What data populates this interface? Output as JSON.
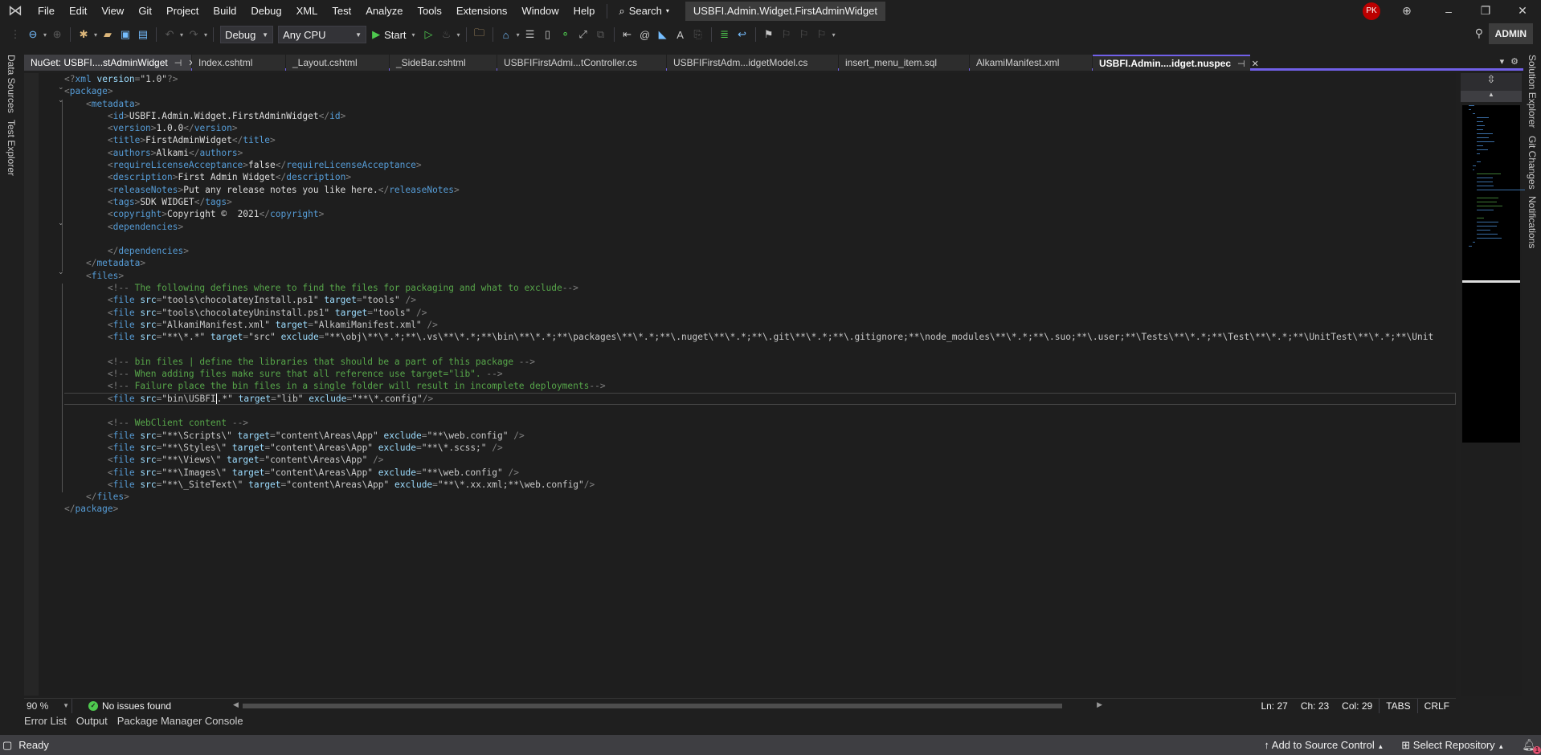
{
  "menubar": {
    "items": [
      "File",
      "Edit",
      "View",
      "Git",
      "Project",
      "Build",
      "Debug",
      "XML",
      "Test",
      "Analyze",
      "Tools",
      "Extensions",
      "Window",
      "Help"
    ],
    "search_label": "Search",
    "solution_title": "USBFI.Admin.Widget.FirstAdminWidget",
    "user_initials": "PK"
  },
  "toolbar": {
    "config": "Debug",
    "platform": "Any CPU",
    "start_label": "Start",
    "admin_label": "ADMIN"
  },
  "side_panels": {
    "left": [
      "Data Sources",
      "Test Explorer"
    ],
    "right": [
      "Solution Explorer",
      "Git Changes",
      "Notifications"
    ]
  },
  "tabs": [
    {
      "label": "NuGet: USBFI....stAdminWidget",
      "pinned": true,
      "state": "preview"
    },
    {
      "label": "Index.cshtml"
    },
    {
      "label": "_Layout.cshtml"
    },
    {
      "label": "_SideBar.cshtml"
    },
    {
      "label": "USBFIFirstAdmi...tController.cs"
    },
    {
      "label": "USBFIFirstAdm...idgetModel.cs"
    },
    {
      "label": "insert_menu_item.sql"
    },
    {
      "label": "AlkamiManifest.xml"
    },
    {
      "label": "USBFI.Admin....idget.nuspec",
      "pinned": true,
      "state": "active"
    }
  ],
  "editor": {
    "lines": [
      [
        [
          "p",
          "<?"
        ],
        [
          "t",
          "xml"
        ],
        [
          "x",
          " "
        ],
        [
          "a",
          "version"
        ],
        [
          "p",
          "="
        ],
        [
          "v",
          "\"1.0\""
        ],
        [
          "p",
          "?>"
        ]
      ],
      [
        [
          "p",
          "<"
        ],
        [
          "t",
          "package"
        ],
        [
          "p",
          ">"
        ]
      ],
      [
        [
          "x",
          "    "
        ],
        [
          "p",
          "<"
        ],
        [
          "t",
          "metadata"
        ],
        [
          "p",
          ">"
        ]
      ],
      [
        [
          "x",
          "        "
        ],
        [
          "p",
          "<"
        ],
        [
          "t",
          "id"
        ],
        [
          "p",
          ">"
        ],
        [
          "x",
          "USBFI.Admin.Widget.FirstAdminWidget"
        ],
        [
          "p",
          "</"
        ],
        [
          "t",
          "id"
        ],
        [
          "p",
          ">"
        ]
      ],
      [
        [
          "x",
          "        "
        ],
        [
          "p",
          "<"
        ],
        [
          "t",
          "version"
        ],
        [
          "p",
          ">"
        ],
        [
          "x",
          "1.0.0"
        ],
        [
          "p",
          "</"
        ],
        [
          "t",
          "version"
        ],
        [
          "p",
          ">"
        ]
      ],
      [
        [
          "x",
          "        "
        ],
        [
          "p",
          "<"
        ],
        [
          "t",
          "title"
        ],
        [
          "p",
          ">"
        ],
        [
          "x",
          "FirstAdminWidget"
        ],
        [
          "p",
          "</"
        ],
        [
          "t",
          "title"
        ],
        [
          "p",
          ">"
        ]
      ],
      [
        [
          "x",
          "        "
        ],
        [
          "p",
          "<"
        ],
        [
          "t",
          "authors"
        ],
        [
          "p",
          ">"
        ],
        [
          "x",
          "Alkami"
        ],
        [
          "p",
          "</"
        ],
        [
          "t",
          "authors"
        ],
        [
          "p",
          ">"
        ]
      ],
      [
        [
          "x",
          "        "
        ],
        [
          "p",
          "<"
        ],
        [
          "t",
          "requireLicenseAcceptance"
        ],
        [
          "p",
          ">"
        ],
        [
          "x",
          "false"
        ],
        [
          "p",
          "</"
        ],
        [
          "t",
          "requireLicenseAcceptance"
        ],
        [
          "p",
          ">"
        ]
      ],
      [
        [
          "x",
          "        "
        ],
        [
          "p",
          "<"
        ],
        [
          "t",
          "description"
        ],
        [
          "p",
          ">"
        ],
        [
          "x",
          "First Admin Widget"
        ],
        [
          "p",
          "</"
        ],
        [
          "t",
          "description"
        ],
        [
          "p",
          ">"
        ]
      ],
      [
        [
          "x",
          "        "
        ],
        [
          "p",
          "<"
        ],
        [
          "t",
          "releaseNotes"
        ],
        [
          "p",
          ">"
        ],
        [
          "x",
          "Put any release notes you like here."
        ],
        [
          "p",
          "</"
        ],
        [
          "t",
          "releaseNotes"
        ],
        [
          "p",
          ">"
        ]
      ],
      [
        [
          "x",
          "        "
        ],
        [
          "p",
          "<"
        ],
        [
          "t",
          "tags"
        ],
        [
          "p",
          ">"
        ],
        [
          "x",
          "SDK WIDGET"
        ],
        [
          "p",
          "</"
        ],
        [
          "t",
          "tags"
        ],
        [
          "p",
          ">"
        ]
      ],
      [
        [
          "x",
          "        "
        ],
        [
          "p",
          "<"
        ],
        [
          "t",
          "copyright"
        ],
        [
          "p",
          ">"
        ],
        [
          "x",
          "Copyright ©  2021"
        ],
        [
          "p",
          "</"
        ],
        [
          "t",
          "copyright"
        ],
        [
          "p",
          ">"
        ]
      ],
      [
        [
          "x",
          "        "
        ],
        [
          "p",
          "<"
        ],
        [
          "t",
          "dependencies"
        ],
        [
          "p",
          ">"
        ]
      ],
      [
        [
          "x",
          ""
        ]
      ],
      [
        [
          "x",
          "        "
        ],
        [
          "p",
          "</"
        ],
        [
          "t",
          "dependencies"
        ],
        [
          "p",
          ">"
        ]
      ],
      [
        [
          "x",
          "    "
        ],
        [
          "p",
          "</"
        ],
        [
          "t",
          "metadata"
        ],
        [
          "p",
          ">"
        ]
      ],
      [
        [
          "x",
          "    "
        ],
        [
          "p",
          "<"
        ],
        [
          "t",
          "files"
        ],
        [
          "p",
          ">"
        ]
      ],
      [
        [
          "x",
          "        "
        ],
        [
          "p",
          "<!--"
        ],
        [
          "c",
          " The following defines where to find the files for packaging and what to exclude"
        ],
        [
          "p",
          "-->"
        ]
      ],
      [
        [
          "x",
          "        "
        ],
        [
          "p",
          "<"
        ],
        [
          "t",
          "file"
        ],
        [
          "x",
          " "
        ],
        [
          "a",
          "src"
        ],
        [
          "p",
          "="
        ],
        [
          "v",
          "\"tools\\chocolateyInstall.ps1\""
        ],
        [
          "x",
          " "
        ],
        [
          "a",
          "target"
        ],
        [
          "p",
          "="
        ],
        [
          "v",
          "\"tools\""
        ],
        [
          "x",
          " "
        ],
        [
          "p",
          "/>"
        ]
      ],
      [
        [
          "x",
          "        "
        ],
        [
          "p",
          "<"
        ],
        [
          "t",
          "file"
        ],
        [
          "x",
          " "
        ],
        [
          "a",
          "src"
        ],
        [
          "p",
          "="
        ],
        [
          "v",
          "\"tools\\chocolateyUninstall.ps1\""
        ],
        [
          "x",
          " "
        ],
        [
          "a",
          "target"
        ],
        [
          "p",
          "="
        ],
        [
          "v",
          "\"tools\""
        ],
        [
          "x",
          " "
        ],
        [
          "p",
          "/>"
        ]
      ],
      [
        [
          "x",
          "        "
        ],
        [
          "p",
          "<"
        ],
        [
          "t",
          "file"
        ],
        [
          "x",
          " "
        ],
        [
          "a",
          "src"
        ],
        [
          "p",
          "="
        ],
        [
          "v",
          "\"AlkamiManifest.xml\""
        ],
        [
          "x",
          " "
        ],
        [
          "a",
          "target"
        ],
        [
          "p",
          "="
        ],
        [
          "v",
          "\"AlkamiManifest.xml\""
        ],
        [
          "x",
          " "
        ],
        [
          "p",
          "/>"
        ]
      ],
      [
        [
          "x",
          "        "
        ],
        [
          "p",
          "<"
        ],
        [
          "t",
          "file"
        ],
        [
          "x",
          " "
        ],
        [
          "a",
          "src"
        ],
        [
          "p",
          "="
        ],
        [
          "v",
          "\"**\\*.*\""
        ],
        [
          "x",
          " "
        ],
        [
          "a",
          "target"
        ],
        [
          "p",
          "="
        ],
        [
          "v",
          "\"src\""
        ],
        [
          "x",
          " "
        ],
        [
          "a",
          "exclude"
        ],
        [
          "p",
          "="
        ],
        [
          "v",
          "\"**\\obj\\**\\*.*;**\\.vs\\**\\*.*;**\\bin\\**\\*.*;**\\packages\\**\\*.*;**\\.nuget\\**\\*.*;**\\.git\\**\\*.*;**\\.gitignore;**\\node_modules\\**\\*.*;**\\.suo;**\\.user;**\\Tests\\**\\*.*;**\\Test\\**\\*.*;**\\UnitTest\\**\\*.*;**\\Unit"
        ]
      ],
      [
        [
          "x",
          ""
        ]
      ],
      [
        [
          "x",
          "        "
        ],
        [
          "p",
          "<!--"
        ],
        [
          "c",
          " bin files | define the libraries that should be a part of this package "
        ],
        [
          "p",
          "-->"
        ]
      ],
      [
        [
          "x",
          "        "
        ],
        [
          "p",
          "<!--"
        ],
        [
          "c",
          " When adding files make sure that all reference use target=\"lib\". "
        ],
        [
          "p",
          "-->"
        ]
      ],
      [
        [
          "x",
          "        "
        ],
        [
          "p",
          "<!--"
        ],
        [
          "c",
          " Failure place the bin files in a single folder will result in incomplete deployments"
        ],
        [
          "p",
          "-->"
        ]
      ],
      [
        [
          "x",
          "        "
        ],
        [
          "p",
          "<"
        ],
        [
          "t",
          "file"
        ],
        [
          "x",
          " "
        ],
        [
          "a",
          "src"
        ],
        [
          "p",
          "="
        ],
        [
          "v",
          "\"bin\\USBFI"
        ],
        [
          "caret",
          ""
        ],
        [
          "v",
          ".*\""
        ],
        [
          "x",
          " "
        ],
        [
          "a",
          "target"
        ],
        [
          "p",
          "="
        ],
        [
          "v",
          "\"lib\""
        ],
        [
          "x",
          " "
        ],
        [
          "a",
          "exclude"
        ],
        [
          "p",
          "="
        ],
        [
          "v",
          "\"**\\*.config\""
        ],
        [
          "p",
          "/>"
        ]
      ],
      [
        [
          "x",
          ""
        ]
      ],
      [
        [
          "x",
          "        "
        ],
        [
          "p",
          "<!--"
        ],
        [
          "c",
          " WebClient content "
        ],
        [
          "p",
          "-->"
        ]
      ],
      [
        [
          "x",
          "        "
        ],
        [
          "p",
          "<"
        ],
        [
          "t",
          "file"
        ],
        [
          "x",
          " "
        ],
        [
          "a",
          "src"
        ],
        [
          "p",
          "="
        ],
        [
          "v",
          "\"**\\Scripts\\\""
        ],
        [
          "x",
          " "
        ],
        [
          "a",
          "target"
        ],
        [
          "p",
          "="
        ],
        [
          "v",
          "\"content\\Areas\\App\""
        ],
        [
          "x",
          " "
        ],
        [
          "a",
          "exclude"
        ],
        [
          "p",
          "="
        ],
        [
          "v",
          "\"**\\web.config\""
        ],
        [
          "x",
          " "
        ],
        [
          "p",
          "/>"
        ]
      ],
      [
        [
          "x",
          "        "
        ],
        [
          "p",
          "<"
        ],
        [
          "t",
          "file"
        ],
        [
          "x",
          " "
        ],
        [
          "a",
          "src"
        ],
        [
          "p",
          "="
        ],
        [
          "v",
          "\"**\\Styles\\\""
        ],
        [
          "x",
          " "
        ],
        [
          "a",
          "target"
        ],
        [
          "p",
          "="
        ],
        [
          "v",
          "\"content\\Areas\\App\""
        ],
        [
          "x",
          " "
        ],
        [
          "a",
          "exclude"
        ],
        [
          "p",
          "="
        ],
        [
          "v",
          "\"**\\*.scss;\""
        ],
        [
          "x",
          " "
        ],
        [
          "p",
          "/>"
        ]
      ],
      [
        [
          "x",
          "        "
        ],
        [
          "p",
          "<"
        ],
        [
          "t",
          "file"
        ],
        [
          "x",
          " "
        ],
        [
          "a",
          "src"
        ],
        [
          "p",
          "="
        ],
        [
          "v",
          "\"**\\Views\\\""
        ],
        [
          "x",
          " "
        ],
        [
          "a",
          "target"
        ],
        [
          "p",
          "="
        ],
        [
          "v",
          "\"content\\Areas\\App\""
        ],
        [
          "x",
          " "
        ],
        [
          "p",
          "/>"
        ]
      ],
      [
        [
          "x",
          "        "
        ],
        [
          "p",
          "<"
        ],
        [
          "t",
          "file"
        ],
        [
          "x",
          " "
        ],
        [
          "a",
          "src"
        ],
        [
          "p",
          "="
        ],
        [
          "v",
          "\"**\\Images\\\""
        ],
        [
          "x",
          " "
        ],
        [
          "a",
          "target"
        ],
        [
          "p",
          "="
        ],
        [
          "v",
          "\"content\\Areas\\App\""
        ],
        [
          "x",
          " "
        ],
        [
          "a",
          "exclude"
        ],
        [
          "p",
          "="
        ],
        [
          "v",
          "\"**\\web.config\""
        ],
        [
          "x",
          " "
        ],
        [
          "p",
          "/>"
        ]
      ],
      [
        [
          "x",
          "        "
        ],
        [
          "p",
          "<"
        ],
        [
          "t",
          "file"
        ],
        [
          "x",
          " "
        ],
        [
          "a",
          "src"
        ],
        [
          "p",
          "="
        ],
        [
          "v",
          "\"**\\_SiteText\\\""
        ],
        [
          "x",
          " "
        ],
        [
          "a",
          "target"
        ],
        [
          "p",
          "="
        ],
        [
          "v",
          "\"content\\Areas\\App\""
        ],
        [
          "x",
          " "
        ],
        [
          "a",
          "exclude"
        ],
        [
          "p",
          "="
        ],
        [
          "v",
          "\"**\\*.xx.xml;**\\web.config\""
        ],
        [
          "p",
          "/>"
        ]
      ],
      [
        [
          "x",
          "    "
        ],
        [
          "p",
          "</"
        ],
        [
          "t",
          "files"
        ],
        [
          "p",
          ">"
        ]
      ],
      [
        [
          "p",
          "</"
        ],
        [
          "t",
          "package"
        ],
        [
          "p",
          ">"
        ]
      ]
    ],
    "current_line_index": 26
  },
  "editor_status": {
    "zoom": "90 %",
    "issues": "No issues found",
    "ln": "Ln: 27",
    "ch": "Ch: 23",
    "col": "Col: 29",
    "indent": "TABS",
    "eol": "CRLF"
  },
  "bottom_tabs": [
    "Error List",
    "Output",
    "Package Manager Console"
  ],
  "statusbar": {
    "ready": "Ready",
    "source_control": "Add to Source Control",
    "repository": "Select Repository",
    "notification_count": "1"
  }
}
